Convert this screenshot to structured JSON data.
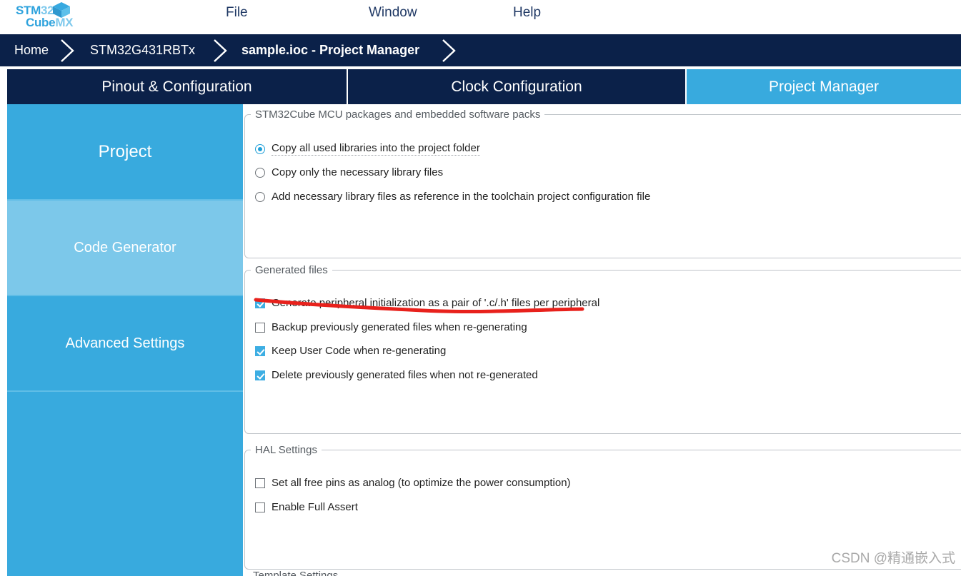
{
  "app": {
    "logo": {
      "line1_dark": "STM",
      "line1_light": "32",
      "line2_dark": "Cube",
      "line2_light": "MX",
      "cube_icon": "cube-icon"
    },
    "accent_blue": "#38aade",
    "navy": "#0b2149",
    "annotation_red": "#e8211c"
  },
  "menu": {
    "items": [
      {
        "label": "File"
      },
      {
        "label": "Window"
      },
      {
        "label": "Help"
      }
    ]
  },
  "breadcrumb": {
    "items": [
      {
        "label": "Home"
      },
      {
        "label": "STM32G431RBTx"
      },
      {
        "label": "sample.ioc - Project Manager"
      }
    ]
  },
  "tabs": [
    {
      "label": "Pinout & Configuration",
      "active": false
    },
    {
      "label": "Clock Configuration",
      "active": false
    },
    {
      "label": "Project Manager",
      "active": true
    }
  ],
  "sidebar": {
    "items": [
      {
        "label": "Project",
        "selected": false
      },
      {
        "label": "Code Generator",
        "selected": true
      },
      {
        "label": "Advanced Settings",
        "selected": false
      }
    ]
  },
  "groups": {
    "packs": {
      "title": "STM32Cube MCU packages and embedded software packs",
      "options": [
        {
          "label": "Copy all used libraries into the project folder",
          "checked": true,
          "focused": true
        },
        {
          "label": "Copy only the necessary library files",
          "checked": false,
          "focused": false
        },
        {
          "label": "Add necessary library files as reference in the toolchain project configuration file",
          "checked": false,
          "focused": false
        }
      ]
    },
    "generated_files": {
      "title": "Generated files",
      "options": [
        {
          "label": "Generate peripheral initialization as a pair of '.c/.h' files per peripheral",
          "checked": true
        },
        {
          "label": "Backup previously generated files when re-generating",
          "checked": false
        },
        {
          "label": "Keep User Code when re-generating",
          "checked": true
        },
        {
          "label": "Delete previously generated files when not re-generated",
          "checked": true
        }
      ]
    },
    "hal_settings": {
      "title": "HAL Settings",
      "options": [
        {
          "label": "Set all free pins as analog (to optimize the power consumption)",
          "checked": false
        },
        {
          "label": "Enable Full Assert",
          "checked": false
        }
      ]
    },
    "template_settings": {
      "title": "Template Settings"
    }
  },
  "watermark": {
    "text": "CSDN @精通嵌入式"
  }
}
